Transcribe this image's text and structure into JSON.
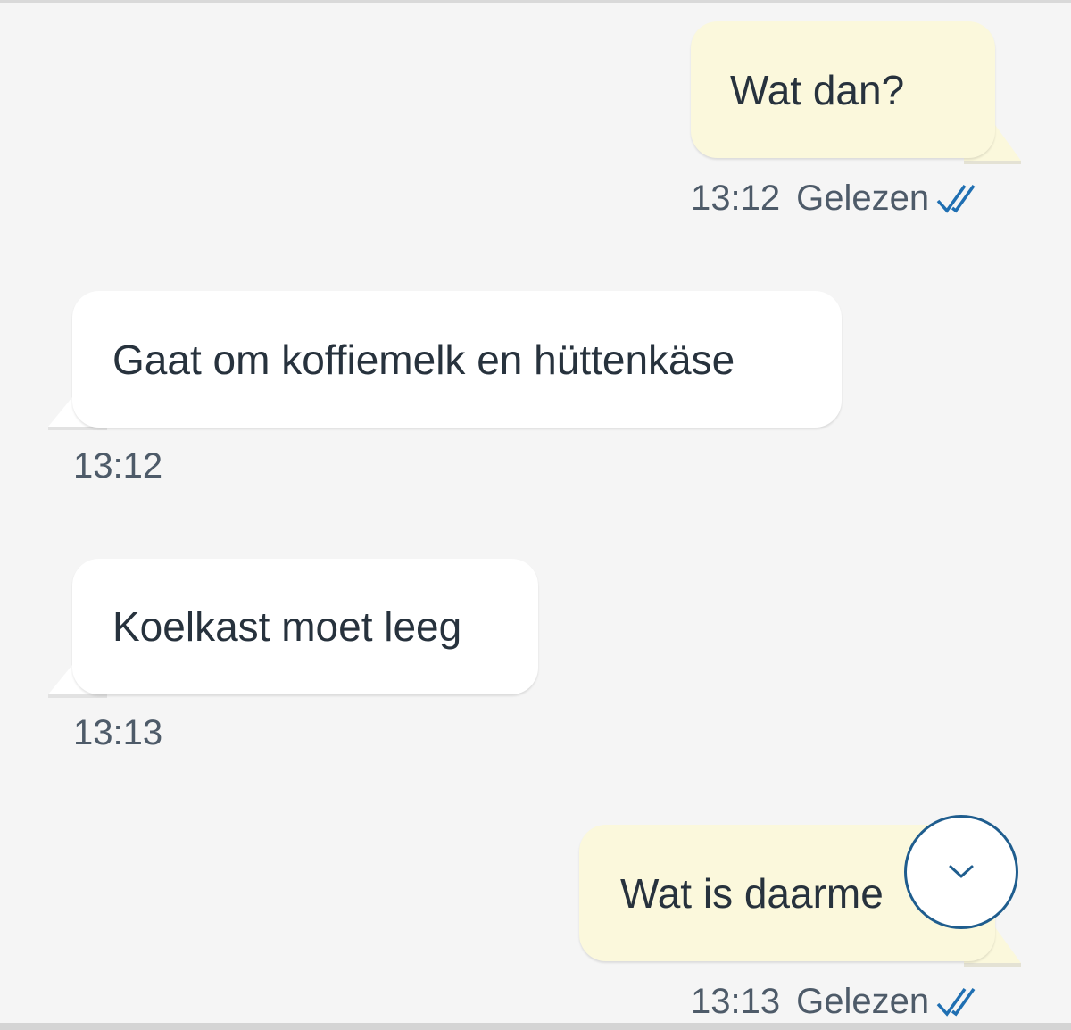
{
  "messages": [
    {
      "direction": "outgoing",
      "text": "Wat dan?",
      "time": "13:12",
      "status": "Gelezen"
    },
    {
      "direction": "incoming",
      "text": "Gaat om koffiemelk en hüttenkäse",
      "time": "13:12"
    },
    {
      "direction": "incoming",
      "text": "Koelkast moet leeg",
      "time": "13:13"
    },
    {
      "direction": "outgoing",
      "text": "Wat is daarme",
      "time": "13:13",
      "status": "Gelezen"
    }
  ],
  "icons": {
    "read_receipt": "double-check-icon",
    "scroll_down": "chevron-down-icon"
  },
  "colors": {
    "background": "#f5f5f5",
    "outgoing_bubble": "#fbf8dc",
    "incoming_bubble": "#ffffff",
    "message_text": "#27323d",
    "meta_text": "#4e5b69",
    "read_check": "#1f6fb2",
    "scroll_button_border": "#1f5d8e"
  }
}
